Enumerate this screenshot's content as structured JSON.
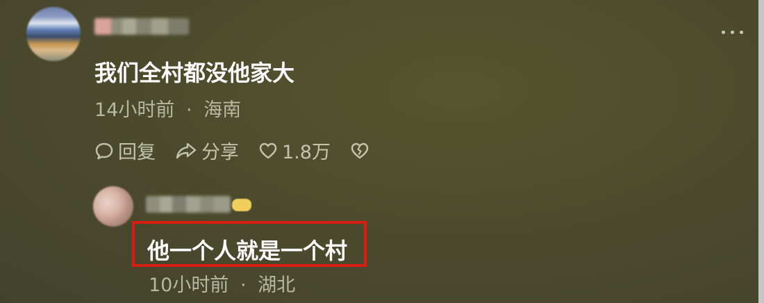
{
  "comment": {
    "text": "我们全村都没他家大",
    "time": "14小时前",
    "separator": "·",
    "location": "海南",
    "actions": {
      "reply_label": "回复",
      "share_label": "分享",
      "like_count": "1.8万"
    }
  },
  "reply": {
    "text": "他一个人就是一个村",
    "time": "10小时前",
    "separator": "·",
    "location": "湖北",
    "highlight_color": "#d91d13"
  },
  "icons": {
    "more": "more-dots-icon",
    "reply": "comment-bubble-icon",
    "share": "share-arrow-icon",
    "like": "heart-icon",
    "dislike": "broken-heart-icon"
  },
  "colors": {
    "background": "#4d4b2d",
    "text": "#ffffff",
    "meta": "#b9b8a3"
  }
}
